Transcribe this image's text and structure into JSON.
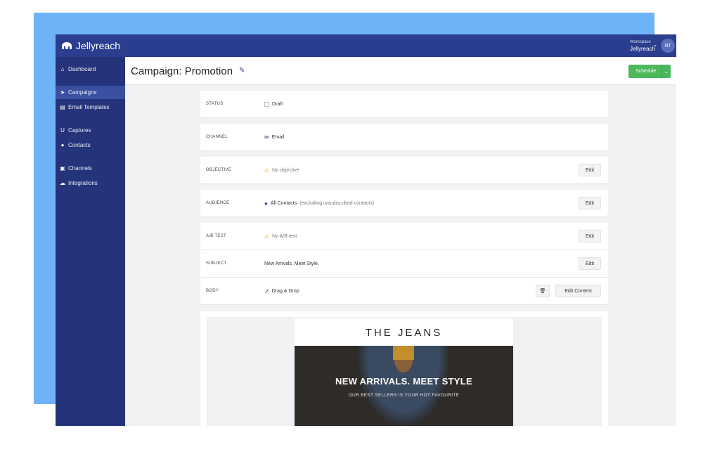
{
  "app": {
    "brand": "Jellyreach"
  },
  "topbar": {
    "workspace_key": "Workspace",
    "workspace_name": "Jellyreach",
    "avatar_initials": "NT"
  },
  "sidebar": {
    "items": [
      {
        "label": "Dashboard",
        "icon": "home-icon"
      },
      {
        "label": "Campaigns",
        "icon": "send-icon",
        "active": true
      },
      {
        "label": "Email Templates",
        "icon": "file-icon"
      },
      {
        "label": "Captures",
        "icon": "magnet-icon"
      },
      {
        "label": "Contacts",
        "icon": "users-icon"
      },
      {
        "label": "Channels",
        "icon": "channels-icon"
      },
      {
        "label": "Integrations",
        "icon": "cloud-icon"
      }
    ]
  },
  "header": {
    "title": "Campaign: Promotion",
    "schedule_label": "Schedule"
  },
  "rows": {
    "status": {
      "key": "STATUS",
      "value": "Draft"
    },
    "channel": {
      "key": "CHANNEL",
      "value": "Email"
    },
    "objective": {
      "key": "OBJECTIVE",
      "value": "No objective",
      "action": "Edit"
    },
    "audience": {
      "key": "AUDIENCE",
      "value": "All Contacts",
      "note": "(excluding unsubscribed contacts)",
      "action": "Edit"
    },
    "abtest": {
      "key": "A/B TEST",
      "value": "No A/B test",
      "action": "Edit"
    },
    "subject": {
      "key": "SUBJECT",
      "value": "New Arrivals. Meet Style.",
      "action": "Edit"
    },
    "body": {
      "key": "BODY",
      "value": "Drag & Drop",
      "action": "Edit Content"
    }
  },
  "email_preview": {
    "brand": "THE JEANS",
    "hero_title": "NEW ARRIVALS. MEET STYLE",
    "hero_subtitle": "OUR BEST SELLERS IS YOUR HOT FAVOURITE"
  },
  "colors": {
    "topbar": "#2b3d8f",
    "sidebar": "#25337a",
    "accent_green": "#4cb85c",
    "backdrop": "#6fb3f7"
  }
}
